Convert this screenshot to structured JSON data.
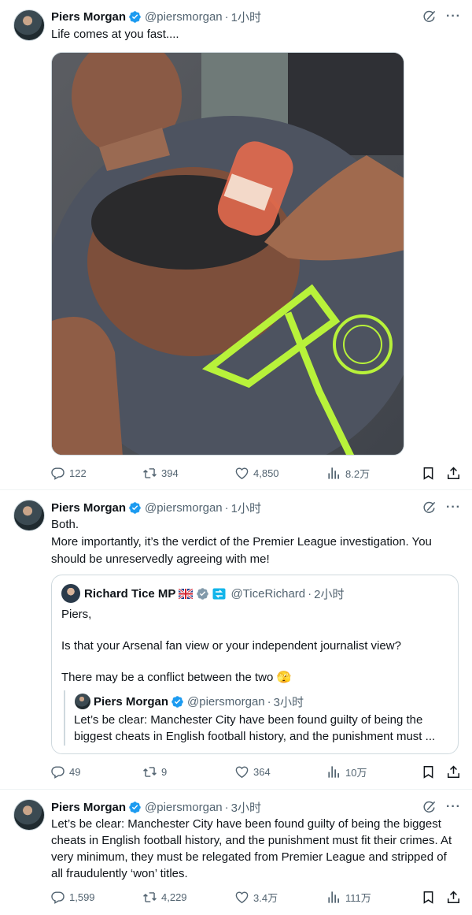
{
  "tweets": [
    {
      "name": "Piers Morgan",
      "handle": "@piersmorgan",
      "dot": "·",
      "time": "1小时",
      "text": "Life comes at you fast....",
      "replies": "122",
      "retweets": "394",
      "likes": "4,850",
      "views": "8.2万"
    },
    {
      "name": "Piers Morgan",
      "handle": "@piersmorgan",
      "dot": "·",
      "time": "1小时",
      "text": "Both.\nMore importantly, it’s the verdict of the Premier League investigation. You should be unreservedly agreeing with me!",
      "replies": "49",
      "retweets": "9",
      "likes": "364",
      "views": "10万",
      "quote": {
        "name": "Richard Tice MP",
        "handle": "@TiceRichard",
        "dot": "·",
        "time": "2小时",
        "text": "Piers,\n\nIs that your Arsenal fan view or your independent journalist view?\n\nThere may be a conflict between the two 🫣",
        "nested": {
          "name": "Piers Morgan",
          "handle": "@piersmorgan",
          "dot": "·",
          "time": "3小时",
          "line1": "Let’s be clear: Manchester City have been found guilty of being the",
          "line2": "biggest cheats in English football history, and the punishment must ..."
        }
      }
    },
    {
      "name": "Piers Morgan",
      "handle": "@piersmorgan",
      "dot": "·",
      "time": "3小时",
      "text": "Let’s be clear: Manchester City have been found guilty of being the biggest cheats in English football history, and the punishment must fit their crimes. At very minimum, they must be relegated from Premier League and stripped of all fraudulently ‘won’ titles.",
      "replies": "1,599",
      "retweets": "4,229",
      "likes": "3.4万",
      "views": "111万"
    }
  ],
  "colors": {
    "verified": "#1d9bf0",
    "muted": "#536471",
    "text": "#0f1419",
    "border": "#cfd9de"
  },
  "icons": [
    "verified-badge-icon",
    "grok-icon",
    "more-icon",
    "reply-icon",
    "retweet-icon",
    "like-icon",
    "views-icon",
    "bookmark-icon",
    "share-icon",
    "uk-flag-icon",
    "gov-badge-icon",
    "affiliate-icon"
  ]
}
